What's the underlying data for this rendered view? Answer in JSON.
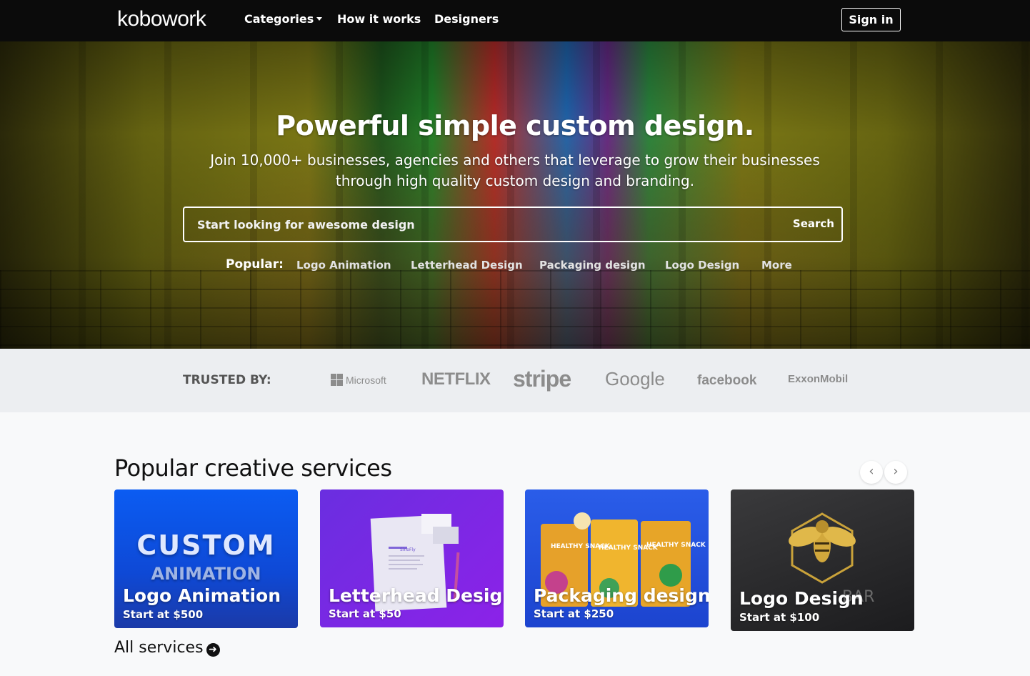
{
  "nav": {
    "logo": "kobowork",
    "links": [
      {
        "label": "Categories"
      },
      {
        "label": "How it works"
      },
      {
        "label": "Designers"
      }
    ],
    "signin_label": "Sign in"
  },
  "hero": {
    "title": "Powerful simple custom design.",
    "subtitle": "Join 10,000+ businesses, agencies and others that leverage to grow their businesses through high quality custom design and branding.",
    "search": {
      "placeholder": "Start looking for awesome design",
      "button_label": "Search"
    },
    "popular_label": "Popular:",
    "popular_links": [
      "Logo Animation",
      "Letterhead Design",
      "Packaging design",
      "Logo Design",
      "More"
    ]
  },
  "trusted": {
    "label": "TRUSTED BY:",
    "brands": [
      "Microsoft",
      "NETFLIX",
      "stripe",
      "Google",
      "facebook",
      "ExxonMobil"
    ]
  },
  "services": {
    "title": "Popular creative services",
    "prev_icon": "chevron-left-icon",
    "next_icon": "chevron-right-icon",
    "cards": [
      {
        "title": "Logo Animation",
        "price": "Start at $500",
        "art_line1": "CUSTOM",
        "art_line2": "ANIMATION"
      },
      {
        "title": "Letterhead Design",
        "price": "Start at $50",
        "art_brand": "SinoFly"
      },
      {
        "title": "Packaging design",
        "price": "Start at $250",
        "art_text": "HEALTHY SNACK"
      },
      {
        "title": "Logo Design",
        "price": "Start at $100",
        "art_text": "BAR"
      }
    ],
    "all_label": "All services"
  },
  "colors": {
    "nav_bg": "#0b0b0b",
    "trusted_bg": "#eceef1",
    "page_bg": "#f8f9fa"
  }
}
